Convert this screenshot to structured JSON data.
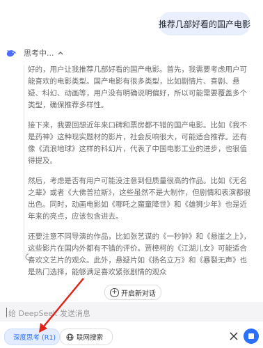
{
  "conversation": {
    "user_message": "推荐几部好看的国产电影",
    "thinking_label": "思考中...",
    "thinking_paragraphs": [
      "好的，用户让我推荐几部好看的国产电影。首先，我需要考虑用户可能喜欢的电影类型。国产电影有很多类型，比如剧情片、喜剧、悬疑、科幻、动画等，用户没有明确说明偏好，所以可能需要覆盖多个类型，确保推荐多样性。",
      "接下来，我要回想近年来口碑和票房都不错的国产电影。比如《我不是药神》这种现实题材的影片，社会反响很大，可能适合推荐。还有像《流浪地球》这样的科幻片，代表了中国电影工业的进步，也很值得提及。",
      "然后，考虑是否有用户可能没注意到但质量很高的作品。比如《无名之辈》或者《大佛普拉斯》，这些虽然不是大制作，但剧情和表演都很出色。同时，动画电影如《哪吒之魔童降世》和《雄狮少年》也是近年来的亮点，应该包含进去。",
      "还要注意不同导演的作品，比如张艺谋的《一秒钟》和《悬崖之上》，这些影片在国内外都有不错的评价。贾樟柯的《江湖儿女》可能适合喜欢文艺片的观众。此外，悬疑片如《扬名立万》和《暴裂无声》也是热门选择，能够满足喜欢紧张剧情的观众"
    ]
  },
  "actions": {
    "new_chat_label": "开启新对话"
  },
  "input": {
    "placeholder": "给 DeepSeek 发送消息"
  },
  "toolbar": {
    "deep_think_label": "深度思考 (R1)",
    "web_search_label": "联网搜索"
  },
  "colors": {
    "accent": "#2b6fff",
    "user_bubble": "#e9effd",
    "annotation_arrow": "#e0241b"
  },
  "icons": {
    "avatar": "deepseek-whale-icon",
    "thinking_toggle": "chevron-up-icon",
    "new_chat": "plus-circle-icon",
    "deep_think": "atom-icon",
    "web_search": "globe-icon",
    "close": "close-icon",
    "send": "stop-icon"
  }
}
